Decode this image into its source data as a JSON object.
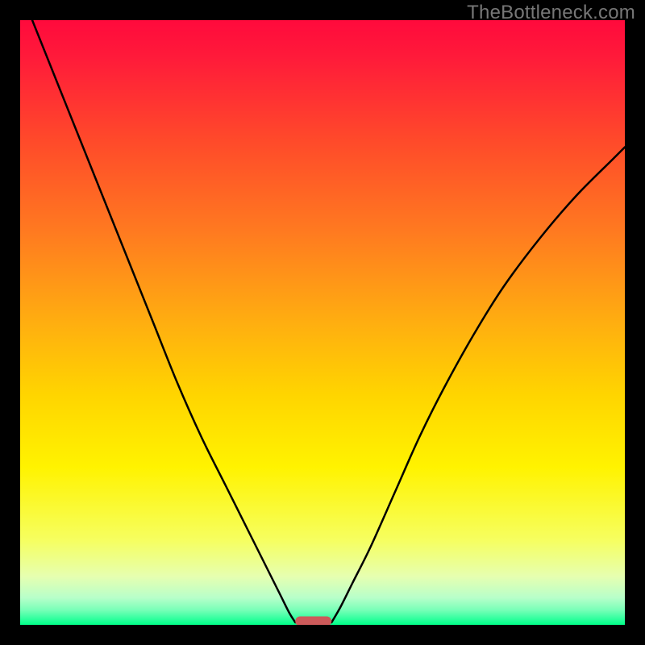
{
  "watermark": "TheBottleneck.com",
  "colors": {
    "frame": "#000000",
    "gradient_stops": [
      {
        "offset": 0.0,
        "color": "#ff0a3c"
      },
      {
        "offset": 0.06,
        "color": "#ff1a3a"
      },
      {
        "offset": 0.2,
        "color": "#ff4a2a"
      },
      {
        "offset": 0.35,
        "color": "#ff7a20"
      },
      {
        "offset": 0.5,
        "color": "#ffae10"
      },
      {
        "offset": 0.62,
        "color": "#ffd500"
      },
      {
        "offset": 0.74,
        "color": "#fff300"
      },
      {
        "offset": 0.86,
        "color": "#f6ff60"
      },
      {
        "offset": 0.92,
        "color": "#e6ffb0"
      },
      {
        "offset": 0.955,
        "color": "#b8ffca"
      },
      {
        "offset": 0.975,
        "color": "#7affb8"
      },
      {
        "offset": 0.99,
        "color": "#30ff9e"
      },
      {
        "offset": 1.0,
        "color": "#00ff88"
      }
    ],
    "curve_stroke": "#000000",
    "marker_fill": "#cc5a5a"
  },
  "chart_data": {
    "type": "line",
    "title": "",
    "xlabel": "",
    "ylabel": "",
    "xlim": [
      0,
      100
    ],
    "ylim": [
      0,
      100
    ],
    "series": [
      {
        "name": "left-curve",
        "x": [
          2,
          6,
          10,
          14,
          18,
          22,
          26,
          30,
          34,
          38,
          41,
          43,
          44.5,
          45.5
        ],
        "y": [
          100,
          90,
          80,
          70,
          60,
          50,
          40,
          31,
          23,
          15,
          9,
          5,
          2,
          0.4
        ]
      },
      {
        "name": "right-curve",
        "x": [
          51.5,
          53,
          55,
          58,
          62,
          66,
          70,
          75,
          80,
          86,
          92,
          98,
          100
        ],
        "y": [
          0.4,
          3,
          7,
          13,
          22,
          31,
          39,
          48,
          56,
          64,
          71,
          77,
          79
        ]
      }
    ],
    "marker": {
      "x_center": 48.5,
      "x_halfwidth": 3.0,
      "y": 0.6
    }
  }
}
